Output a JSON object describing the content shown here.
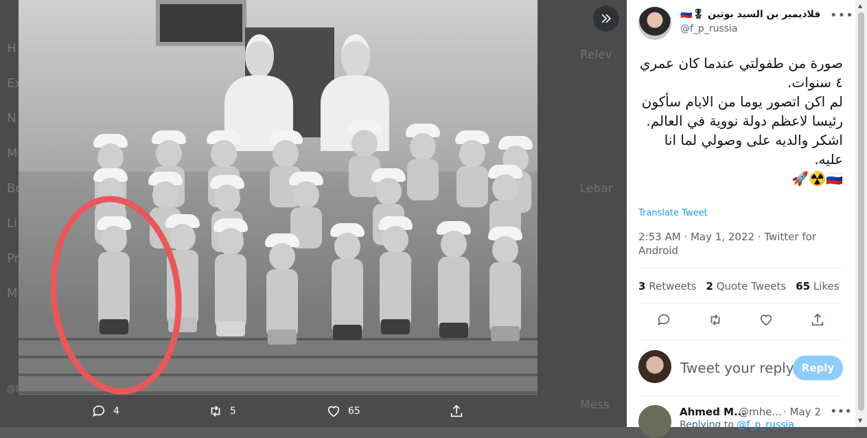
{
  "background": {
    "nav_letters": [
      "H",
      "Ex",
      "N",
      "M",
      "Bo",
      "Li",
      "Pr",
      "M"
    ],
    "right_labels": [
      "Relev",
      "Lebar",
      "Mess"
    ],
    "bottom_handle": "@HalaHomsi"
  },
  "media_actions": {
    "reply_count": "4",
    "retweet_count": "5",
    "like_count": "65"
  },
  "tweet": {
    "author_name": "فلاديمير بن السيد بوتين",
    "author_badges": "🎖🇷🇺",
    "author_handle": "@f_p_russia",
    "text": "صورة من طفولتي عندما كان عمري ٤ سنوات.\nلم اكن اتصور يوما من الايام سأكون رئيسا لاعظم دولة نووية في العالم.\nاشكر والديه على وصولي لما انا عليه.\n🇷🇺☢️🚀",
    "translate_label": "Translate Tweet",
    "timestamp": "2:53 AM · May 1, 2022 · Twitter for Android",
    "stats": {
      "retweets_value": "3",
      "retweets_label": "Retweets",
      "quotes_value": "2",
      "quotes_label": "Quote Tweets",
      "likes_value": "65",
      "likes_label": "Likes"
    }
  },
  "reply_box": {
    "placeholder": "Tweet your reply",
    "button_label": "Reply"
  },
  "comment": {
    "name": "Ahmed M...",
    "handle": "@mhe...",
    "date": "· May 2",
    "replying_prefix": "Replying to",
    "replying_handle": "@f_p_russia"
  },
  "colors": {
    "accent": "#1d9bf0",
    "reply_button": "#8ecdf8",
    "circle_highlight": "#e8585a"
  }
}
